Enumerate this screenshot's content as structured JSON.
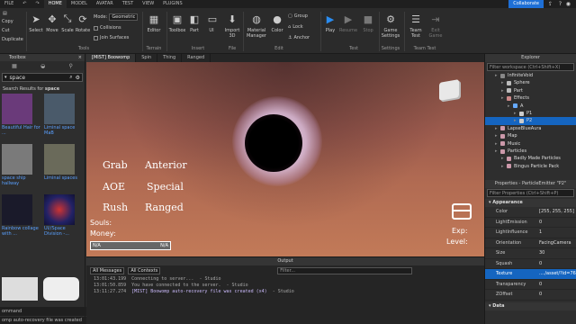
{
  "menubar": {
    "items": [
      "FILE",
      "HOME",
      "MODEL",
      "AVATAR",
      "TEST",
      "VIEW",
      "PLUGINS"
    ],
    "active_index": 1,
    "collaborate": "Collaborate"
  },
  "ribbon": {
    "clipboard": {
      "copy": "Copy",
      "cut": "Cut",
      "duplicate": "Duplicate",
      "paste_hidden": true
    },
    "tools": {
      "select": "Select",
      "move": "Move",
      "scale": "Scale",
      "rotate": "Rotate",
      "group_label": "Tools"
    },
    "mode": {
      "label": "Mode:",
      "value": "Geometric",
      "collisions": "Collisions",
      "join_surfaces": "Join Surfaces"
    },
    "terrain": {
      "editor": "Editor",
      "group_label": "Terrain"
    },
    "insert": {
      "toolbox": "Toolbox",
      "part": "Part",
      "ui": "UI",
      "import3d": "Import 3D",
      "group_label": "Insert",
      "file_label": "File"
    },
    "edit": {
      "material_manager": "Material Manager",
      "color": "Color",
      "group": "Group",
      "lock": "Lock",
      "anchor": "Anchor",
      "group_label": "Edit"
    },
    "test": {
      "play": "Play",
      "resume": "Resume",
      "stop": "Stop",
      "group_label": "Test"
    },
    "settings": {
      "game_settings": "Game Settings",
      "group_label": "Settings"
    },
    "team_test": {
      "team_test": "Team Test",
      "exit_game": "Exit Game",
      "group_label": "Team Test"
    }
  },
  "toolbox": {
    "title": "Toolbox",
    "search_value": "space",
    "results_label": "Search Results for ",
    "results_term": "space",
    "items": [
      {
        "caption": "Beautiful Hair for ...",
        "color": "#6a3a7a"
      },
      {
        "caption": "Liminal space MaB",
        "color": "#4a5a6a"
      },
      {
        "caption": "space ship hallway",
        "color": "#7a7a7a"
      },
      {
        "caption": "Liminal spaces",
        "color": "#6a6a5a"
      },
      {
        "caption": "Rainbow collage with ...",
        "color": "#1a1a2a"
      },
      {
        "caption": "UI//Space Division -...",
        "color": "#3a5a9a"
      }
    ]
  },
  "doctabs": [
    "[MIST] Boowomp",
    "Spin",
    "Thing",
    "Ranged"
  ],
  "viewport": {
    "skills": [
      "Grab",
      "Anterior",
      "AOE",
      "Special",
      "Rush",
      "Ranged"
    ],
    "souls_label": "Souls:",
    "money_label": "Money:",
    "bar_left": "N/A",
    "bar_right": "N/A",
    "bar_fill_fraction": 0.0,
    "exp_label": "Exp:",
    "level_label": "Level:"
  },
  "output": {
    "title": "Output",
    "filter_messages": "All Messages",
    "filter_contexts": "All Contexts",
    "filter_placeholder": "Filter...",
    "lines": [
      {
        "time": "13:01:43.199",
        "text": "Connecting to server...",
        "source": "- Studio",
        "color": "#aaaaaa"
      },
      {
        "time": "13:01:50.859",
        "text": "You have connected to the server.",
        "source": "- Studio",
        "color": "#aaaaaa"
      },
      {
        "time": "13:11:27.274",
        "text": "[MIST] Boowomp auto-recovery file was created (x4)",
        "source": "- Studio",
        "color": "#c8b8f8"
      }
    ]
  },
  "explorer": {
    "title": "Explorer",
    "filter_placeholder": "Filter workspace (Ctrl+Shift+X)",
    "rows": [
      {
        "label": "InfiniteVoid",
        "indent": 1,
        "icon": "#888",
        "selected": false
      },
      {
        "label": "Sphere",
        "indent": 2,
        "icon": "#bbb",
        "selected": false
      },
      {
        "label": "Part",
        "indent": 2,
        "icon": "#bbb",
        "selected": false
      },
      {
        "label": "Effects",
        "indent": 2,
        "icon": "#c88",
        "selected": false
      },
      {
        "label": "A",
        "indent": 3,
        "icon": "#6af",
        "selected": false
      },
      {
        "label": "P1",
        "indent": 4,
        "icon": "#ccc",
        "selected": false
      },
      {
        "label": "P2",
        "indent": 4,
        "icon": "#ccc",
        "selected": true
      },
      {
        "label": "LapseBlueAura",
        "indent": 1,
        "icon": "#c9a",
        "selected": false
      },
      {
        "label": "Map",
        "indent": 1,
        "icon": "#c9a",
        "selected": false
      },
      {
        "label": "Music",
        "indent": 1,
        "icon": "#c9a",
        "selected": false
      },
      {
        "label": "Particles",
        "indent": 1,
        "icon": "#c9a",
        "selected": false
      },
      {
        "label": "Badly Made Particles",
        "indent": 2,
        "icon": "#c9a",
        "selected": false
      },
      {
        "label": "Bingus Particle Pack",
        "indent": 2,
        "icon": "#c9a",
        "selected": false
      }
    ]
  },
  "properties": {
    "title": "Properties - ParticleEmitter \"P2\"",
    "filter_placeholder": "Filter Properties (Ctrl+Shift+P)",
    "category_appearance": "Appearance",
    "rows": [
      {
        "name": "Color",
        "value": "[255, 255, 255]",
        "selected": false
      },
      {
        "name": "LightEmission",
        "value": "0",
        "selected": false
      },
      {
        "name": "LightInfluence",
        "value": "1",
        "selected": false
      },
      {
        "name": "Orientation",
        "value": "FacingCamera",
        "selected": false
      },
      {
        "name": "Size",
        "value": "30",
        "selected": false
      },
      {
        "name": "Squash",
        "value": "0",
        "selected": false
      },
      {
        "name": "Texture",
        "value": "..../asset/?id=7605...",
        "selected": true
      },
      {
        "name": "Transparency",
        "value": "0",
        "selected": false
      },
      {
        "name": "ZOffset",
        "value": "0",
        "selected": false
      }
    ],
    "category_data": "Data"
  },
  "statusbar": {
    "left_text": "omp auto-recovery file was created",
    "command_label": "ommand"
  }
}
